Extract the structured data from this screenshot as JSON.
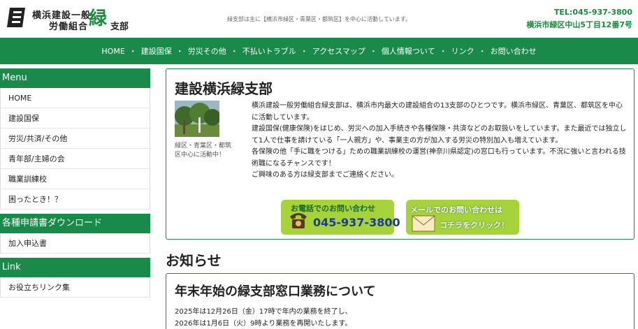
{
  "header": {
    "logo": {
      "line1": "横浜建設一般",
      "line2": "労働組合",
      "green_char": "緑",
      "branch": "支部"
    },
    "tagline": "緑支部は主に【横浜市緑区・青葉区・都筑区】を中心に活動しています。",
    "tel": "TEL:045-937-3800",
    "address": "横浜市緑区中山5丁目12番7号"
  },
  "nav": {
    "items": [
      "HOME",
      "建設国保",
      "労災その他",
      "不払いトラブル",
      "アクセスマップ",
      "個人情報ついて",
      "リンク",
      "お問い合わせ"
    ],
    "separator": "・"
  },
  "sidebar": {
    "menu_heading": "Menu",
    "menu_items": [
      "HOME",
      "建設国保",
      "労災/共済/その他",
      "青年部/主婦の会",
      "職業訓練校",
      "困ったとき！？"
    ],
    "download_heading": "各種申請書ダウンロード",
    "download_items": [
      "加入申込書"
    ],
    "link_heading": "Link",
    "link_items": [
      "お役立ちリンク集"
    ]
  },
  "main": {
    "title": "建設横浜緑支部",
    "photo_caption": "緑区・青葉区・都筑区中心に活動中！",
    "paragraph": "横浜建設一般労働組合緑支部は、横浜市内最大の建設組合の13支部のひとつです。横浜市緑区、青葉区、都筑区を中心に活動しています。\n建設国保(健康保険)をはじめ、労災への加入手続きや各種保険・共済などのお取扱いをしています。また最近では独立して1人で仕事を請けている「一人親方」や、事業主の方が加入する労災の特別加入も増えています。\n各保険の他「手に職をつける」ための職業訓練校の運営(神奈川県認定)の窓口も行っています。不況に強いと言われる技術職になるチャンスです！\nご興味のある方は緑支部までご連絡ください。",
    "tel_button": {
      "label": "お電話でのお問い合わせ",
      "number": "045-937-3800"
    },
    "mail_button": {
      "label": "メールでのお問い合わせは",
      "action": "コチラをクリック！"
    }
  },
  "news": {
    "heading": "お知らせ",
    "title": "年末年始の緑支部窓口業務について",
    "lines": [
      "2025年は12月26日（金）17時で年内の業務を終了し、",
      "2026年は1月6日（火）9時より業務を再開いたします。"
    ]
  },
  "colors": {
    "brand_green": "#1a8a4a",
    "button_green": "#a6d23c",
    "tel_blue": "#1e3c8c"
  }
}
